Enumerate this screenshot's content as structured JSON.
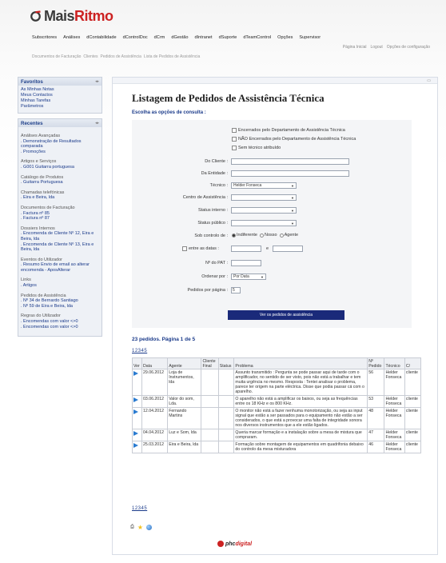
{
  "brand": {
    "name_main": "Mais",
    "name_accent": "Ritmo",
    "colors": {
      "accent": "#cc2222",
      "link": "#1a3a8a",
      "button": "#1a2a7a"
    }
  },
  "topnav": [
    "Subscritores",
    "Análises",
    "dContabilidade",
    "dControlDoc",
    "dCrm",
    "dGestão",
    "dIntranet",
    "dSuporte",
    "dTeamControl",
    "Opções",
    "Supervisor"
  ],
  "toplinks": [
    "Página Inicial",
    "Logout",
    "Opções de configuração"
  ],
  "breadcrumb": [
    "Documentos de Facturação",
    "Clientes",
    "Pedidos de Assistência",
    "Lista de Pedidos de Assistência"
  ],
  "favoritos": {
    "title": "Favoritos",
    "items": [
      "As Minhas Notas",
      "Meus Contactos",
      "Minhas Tarefas",
      "Parâmetros"
    ]
  },
  "recentes": {
    "title": "Recentes",
    "groups": [
      {
        "title": "Análises Avançadas",
        "items": [
          ". Demonstração de Resultados comparada",
          ". Promoções"
        ]
      },
      {
        "title": "Artigos e Serviços",
        "items": [
          ". G001 Guitarra portuguesa"
        ]
      },
      {
        "title": "Catálogo de Produtos",
        "items": [
          ". Guitarra Portuguesa"
        ]
      },
      {
        "title": "Chamadas telefónicas",
        "items": [
          ". Eira e Beira, lda"
        ]
      },
      {
        "title": "Documentos de Facturação",
        "items": [
          ". Factura nº 85",
          ". Factura nº 87"
        ]
      },
      {
        "title": "Dossiers Internos",
        "items": [
          ". Encomenda de Cliente Nº 12, Eira e Beira, lda",
          ". Encomenda de Cliente Nº 13, Eira e Beira, lda"
        ]
      },
      {
        "title": "Eventos do Utilizador",
        "items": [
          ". Resumo Envio de email ao alterar encomenda - AposAlterar"
        ]
      },
      {
        "title": "Links",
        "items": [
          ". Artigos"
        ]
      },
      {
        "title": "Pedidos de Assistência",
        "items": [
          ". Nº 34 de Bernardo Santiago",
          ". Nº 59 de Eira e Beira, lda"
        ]
      },
      {
        "title": "Regras do Utilizador",
        "items": [
          ". Encomendas com valor <>0",
          ". Encomendas com valor <>0"
        ]
      }
    ]
  },
  "main": {
    "title": "Listagem de Pedidos de Assistência Técnica",
    "subtitle": "Escolha as opções de consulta :",
    "checks": [
      {
        "label": "Encerrados pelo Departamento de Assistência Técnica",
        "checked": false
      },
      {
        "label": "NÃO Encerrados pelo Departamento de Assistência Técnica",
        "checked": false
      },
      {
        "label": "Sem técnico atribuído",
        "checked": false
      }
    ],
    "fields": {
      "cliente": "Do Cliente :",
      "entidade": "Da Entidade :",
      "tecnico": "Técnico :",
      "tecnico_value": "Helder Fonseca",
      "centro": "Centro de Assistência :",
      "status_interno": "Status interno :",
      "status_publico": "Status público :",
      "sob_controlo": "Sob controlo de :",
      "radio_options": [
        "Indiferente",
        "Nosso",
        "Agente"
      ],
      "radio_selected": "Indiferente",
      "entre_datas": "entre as datas :",
      "e": "e",
      "pat": "Nº do PAT :",
      "ordenar": "Ordenar por :",
      "ordenar_value": "Por Data",
      "pedidos_pagina": "Pedidos por página :",
      "pedidos_pagina_value": "5"
    },
    "submit_label": "Ver os pedidos de assistência",
    "results_title": "23 pedidos. Página 1 de 5",
    "pager": "12345",
    "table": {
      "headers": [
        "Ver",
        "Data",
        "Agente",
        "Cliente Final",
        "Status",
        "Problema",
        "Nº Pedido",
        "Técnico",
        "C/"
      ],
      "rows": [
        {
          "data": "29.06.2012",
          "agente": "Loja de Instrumentos, lda",
          "problema": "Assunto transmitido : Pergunta se pode passar aqui de tarde com o amplificador, no sentido de ser visto, pois não está a trabalhar e tem muita urgência no mesmo. Resposta : Tentei analisar o problema, parece ter origem na parte eléctrica. Disse que podia passar cá com o aparelho.",
          "numero": "56",
          "tecnico": "Helder Fonseca",
          "c": "cliente"
        },
        {
          "data": "03.06.2012",
          "agente": "Valor do som, Lda.",
          "problema": "O aparelho não está a amplificar os baixos, ou seja as frequências entre os 18 KHz e os 800 KHz.",
          "numero": "53",
          "tecnico": "Helder Fonseca",
          "c": "cliente"
        },
        {
          "data": "12.04.2012",
          "agente": "Fernando Martins",
          "problema": "O monitor não está a fazer nenhuma monotorização, ou seja as input signal que estão a ser passados para o equipamento não estão a ser considerados, o que está a provocar uma falta de integridade sonora nos diversos instrumentos que a ele estão ligados.",
          "numero": "48",
          "tecnico": "Helder Fonseca",
          "c": "cliente"
        },
        {
          "data": "04.04.2012",
          "agente": "Luz e Som, lda",
          "problema": "Queria marcar formação e a instalação sobre a mesa de mistura que compraram.",
          "numero": "47",
          "tecnico": "Helder Fonseca",
          "c": "cliente"
        },
        {
          "data": "25.03.2012",
          "agente": "Eira e Beira, lda",
          "problema": "Formação sobre montagem de equipamentos em quadrifonia debaixo do controlo da mesa misturadora",
          "numero": "46",
          "tecnico": "Helder Fonseca",
          "c": "cliente"
        }
      ]
    }
  },
  "footer": {
    "icons": [
      "print-icon",
      "star-icon",
      "globe-icon"
    ],
    "brand_main": "phc",
    "brand_accent": "digital"
  }
}
